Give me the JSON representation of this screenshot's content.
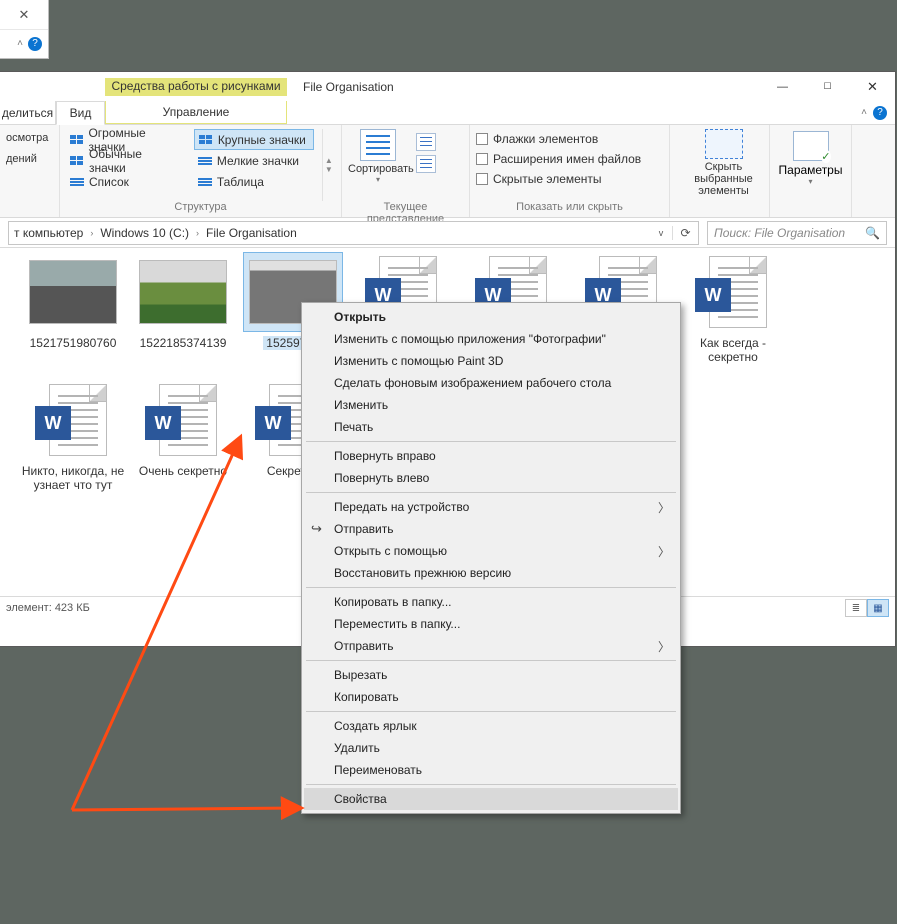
{
  "remnant": {
    "close_glyph": "✕",
    "chev": "˄",
    "help": "?"
  },
  "window": {
    "contextual_tab": "Средства работы с рисунками",
    "title": "File Organisation",
    "minimize": "—",
    "maximize": "☐",
    "close": "✕"
  },
  "tabs": {
    "left_frag": "делиться",
    "active": "Вид",
    "sub": "Управление",
    "chev": "˄",
    "help": "?"
  },
  "ribbon": {
    "group1_frag": [
      "осмотра",
      "дений"
    ],
    "layout": {
      "opts_left": [
        "Огромные значки",
        "Обычные значки",
        "Список"
      ],
      "opts_right": [
        "Крупные значки",
        "Мелкие значки",
        "Таблица"
      ],
      "label": "Структура"
    },
    "view": {
      "sort": "Сортировать",
      "label": "Текущее представление"
    },
    "show": {
      "chk1": "Флажки элементов",
      "chk2": "Расширения имен файлов",
      "chk3": "Скрытые элементы",
      "hide": "Скрыть выбранные элементы",
      "label": "Показать или скрыть"
    },
    "params": {
      "label": "Параметры"
    }
  },
  "breadcrumb": {
    "c1": "т компьютер",
    "c2": "Windows 10 (C:)",
    "c3": "File Organisation"
  },
  "search_placeholder": "Поиск: File Organisation",
  "files": [
    {
      "kind": "img",
      "label": "1521751980760"
    },
    {
      "kind": "img-green",
      "label": "1522185374139"
    },
    {
      "kind": "img-bw",
      "label": "15259798",
      "selected": true
    },
    {
      "kind": "word",
      "label": ""
    },
    {
      "kind": "word",
      "label": ""
    },
    {
      "kind": "word",
      "label": ""
    },
    {
      "kind": "word",
      "label": "Как всегда - секретно"
    },
    {
      "kind": "word",
      "label": "Никто, никогда, не узнает что тут"
    },
    {
      "kind": "word",
      "label": "Очень секретно"
    },
    {
      "kind": "word",
      "label": "Секретно"
    }
  ],
  "status": "элемент: 423 КБ",
  "context_menu": [
    {
      "t": "item",
      "label": "Открыть",
      "bold": true
    },
    {
      "t": "item",
      "label": "Изменить с помощью приложения \"Фотографии\""
    },
    {
      "t": "item",
      "label": "Изменить с помощью Paint 3D"
    },
    {
      "t": "item",
      "label": "Сделать фоновым изображением рабочего стола"
    },
    {
      "t": "item",
      "label": "Изменить"
    },
    {
      "t": "item",
      "label": "Печать"
    },
    {
      "t": "sep"
    },
    {
      "t": "item",
      "label": "Повернуть вправо"
    },
    {
      "t": "item",
      "label": "Повернуть влево"
    },
    {
      "t": "sep"
    },
    {
      "t": "item",
      "label": "Передать на устройство",
      "sub": true
    },
    {
      "t": "item",
      "label": "Отправить",
      "icon": "share"
    },
    {
      "t": "item",
      "label": "Открыть с помощью",
      "sub": true
    },
    {
      "t": "item",
      "label": "Восстановить прежнюю версию"
    },
    {
      "t": "sep"
    },
    {
      "t": "item",
      "label": "Копировать в папку..."
    },
    {
      "t": "item",
      "label": "Переместить в папку..."
    },
    {
      "t": "item",
      "label": "Отправить",
      "sub": true
    },
    {
      "t": "sep"
    },
    {
      "t": "item",
      "label": "Вырезать"
    },
    {
      "t": "item",
      "label": "Копировать"
    },
    {
      "t": "sep"
    },
    {
      "t": "item",
      "label": "Создать ярлык"
    },
    {
      "t": "item",
      "label": "Удалить"
    },
    {
      "t": "item",
      "label": "Переименовать"
    },
    {
      "t": "sep"
    },
    {
      "t": "item",
      "label": "Свойства",
      "hover": true
    }
  ]
}
